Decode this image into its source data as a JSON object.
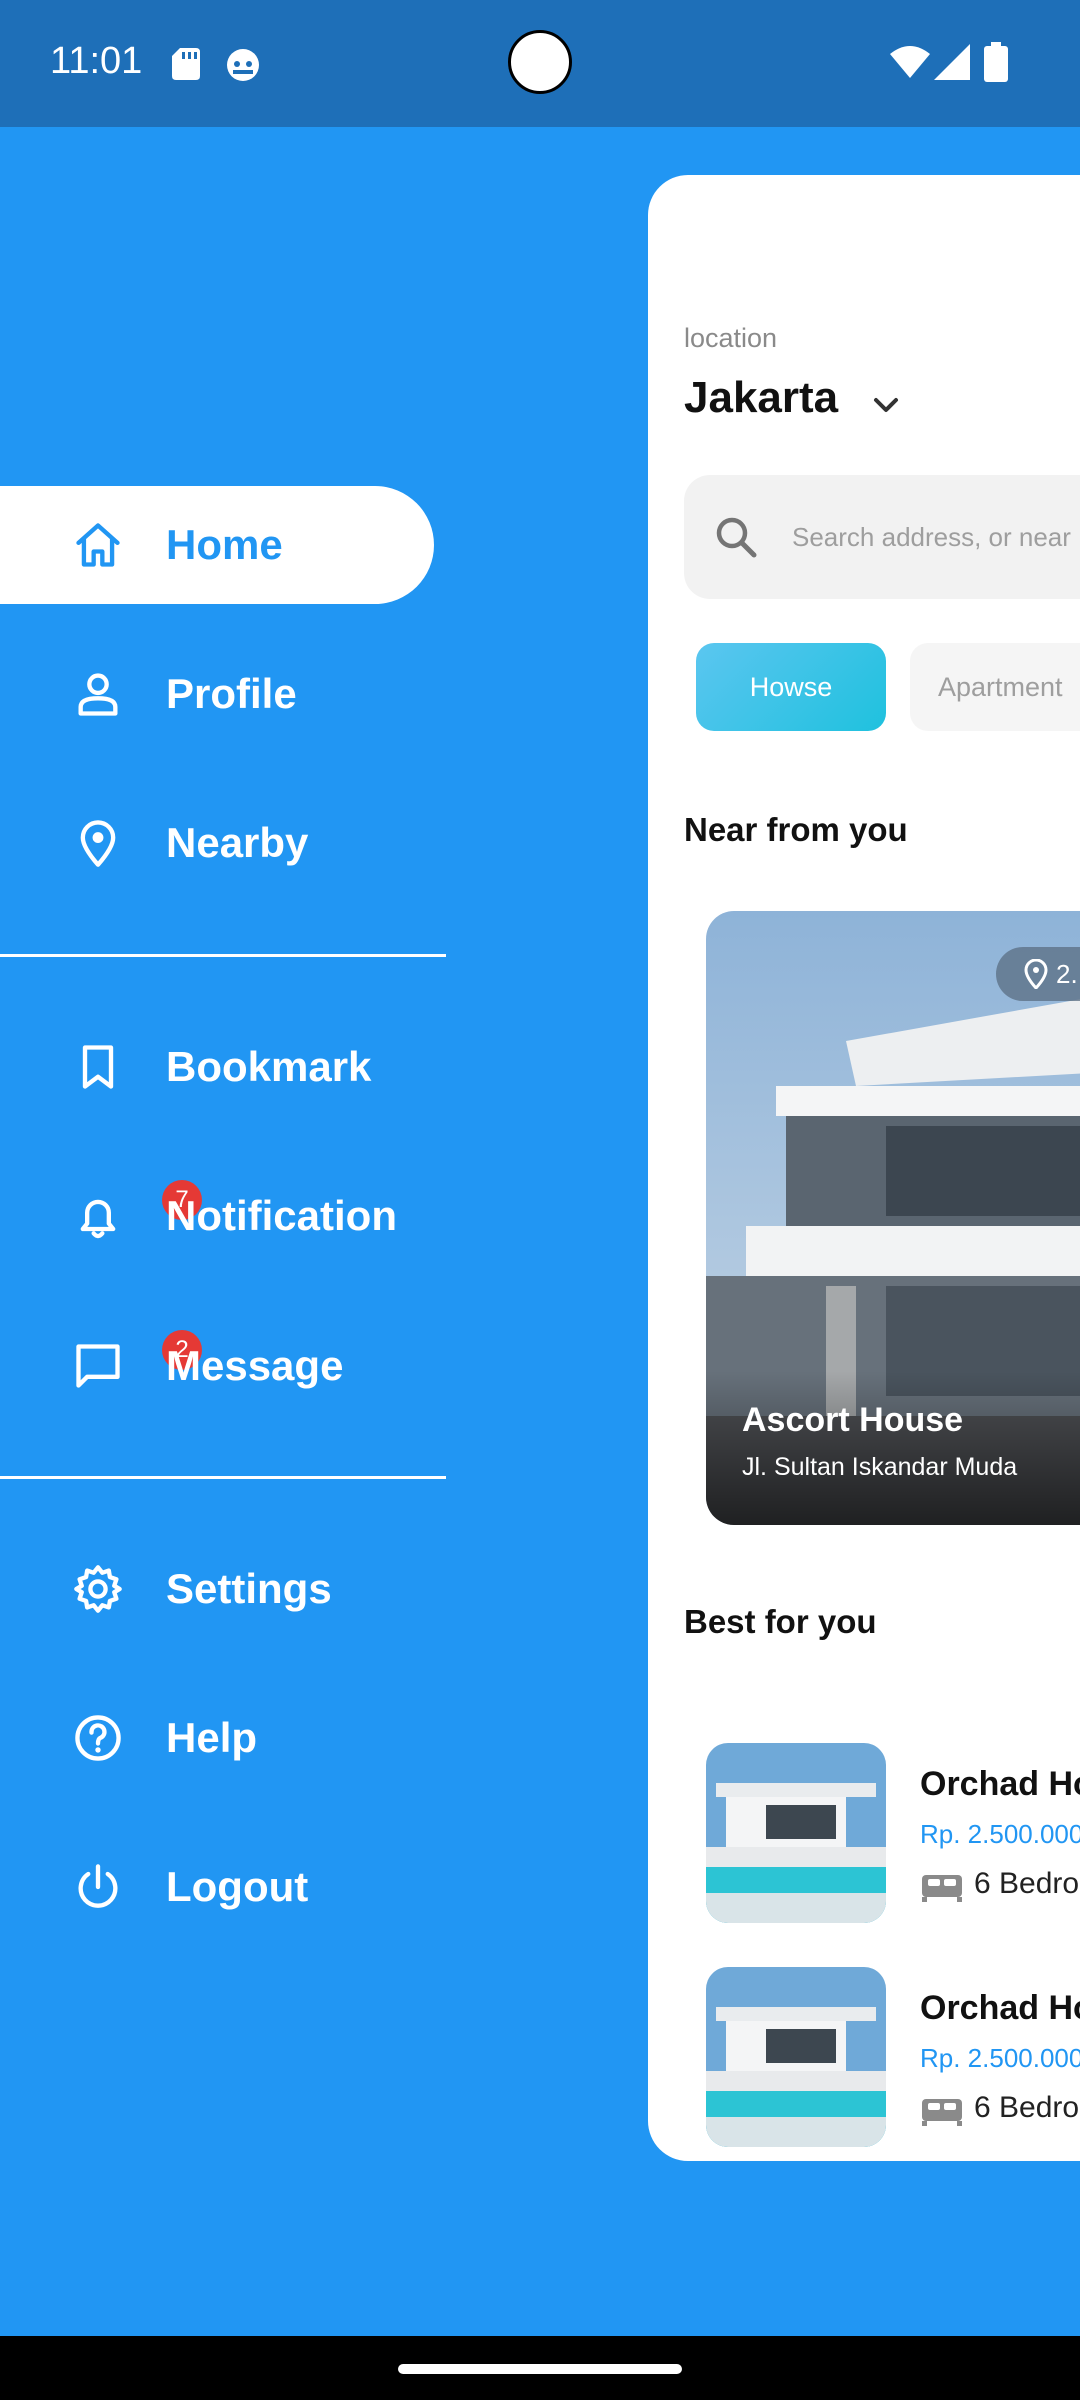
{
  "status_bar": {
    "time": "11:01"
  },
  "drawer": {
    "primary": [
      {
        "label": "Home",
        "icon": "home-icon",
        "active": true
      },
      {
        "label": "Profile",
        "icon": "person-icon"
      },
      {
        "label": "Nearby",
        "icon": "location-pin-icon"
      }
    ],
    "secondary": [
      {
        "label": "Bookmark",
        "icon": "bookmark-icon"
      },
      {
        "label": "Notification",
        "icon": "bell-icon",
        "badge": "7"
      },
      {
        "label": "Message",
        "icon": "chat-icon",
        "badge": "2"
      }
    ],
    "tertiary": [
      {
        "label": "Settings",
        "icon": "gear-icon"
      },
      {
        "label": "Help",
        "icon": "help-icon"
      },
      {
        "label": "Logout",
        "icon": "power-icon"
      }
    ]
  },
  "main": {
    "location_caption": "location",
    "location_city": "Jakarta",
    "search_placeholder": "Search address, or near",
    "categories": [
      "Howse",
      "Apartment"
    ],
    "near_title": "Near from you",
    "featured": {
      "name": "Ascort House",
      "address": "Jl. Sultan Iskandar Muda",
      "distance": "2."
    },
    "best_title": "Best for you",
    "best": [
      {
        "name": "Orchad Ho",
        "price": "Rp. 2.500.000",
        "beds": "6 Bedro"
      },
      {
        "name": "Orchad Ho",
        "price": "Rp. 2.500.000",
        "beds": "6 Bedro"
      }
    ]
  },
  "colors": {
    "primary": "#2196F3",
    "status_bar": "#1E6FB8",
    "badge": "#E53935",
    "chip_active": "#1FC1DE"
  }
}
